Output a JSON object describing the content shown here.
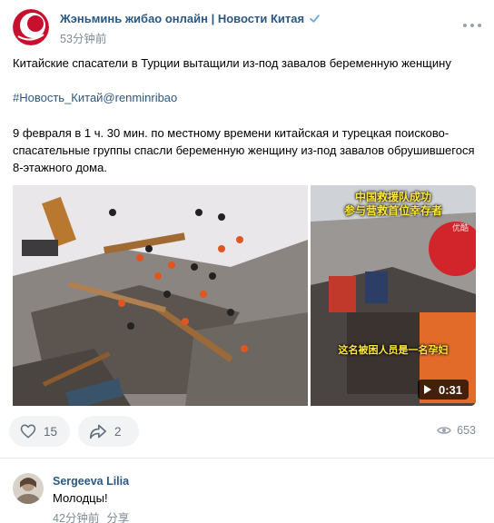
{
  "post": {
    "author": "Жэньминь жибао онлайн | Новости Китая",
    "time": "53分钟前",
    "text_title": "Китайские спасатели в Турции вытащили из-под завалов беременную женщину",
    "hashtag": "#Новость_Китай@renminribao",
    "text_body": "9 февраля в 1 ч. 30 мин. по местному времени китайская и турецкая поисково-спасательные группы спасли беременную женщину из-под завалов обрушившегося 8-этажного дома."
  },
  "video": {
    "title_line1": "中国救援队成功",
    "title_line2": "参与营救首位幸存者",
    "caption": "这名被困人员是一名孕妇",
    "watermark": "优酷",
    "duration": "0:31"
  },
  "actions": {
    "likes": "15",
    "shares": "2",
    "views": "653"
  },
  "comment": {
    "author": "Sergeeva Lilia",
    "text": "Молодцы!",
    "time": "42分钟前",
    "share_label": "分享"
  },
  "colors": {
    "link": "#2a5885",
    "secondary": "#818c99",
    "button_bg": "#f2f3f5",
    "logo_red": "#c8102e"
  }
}
